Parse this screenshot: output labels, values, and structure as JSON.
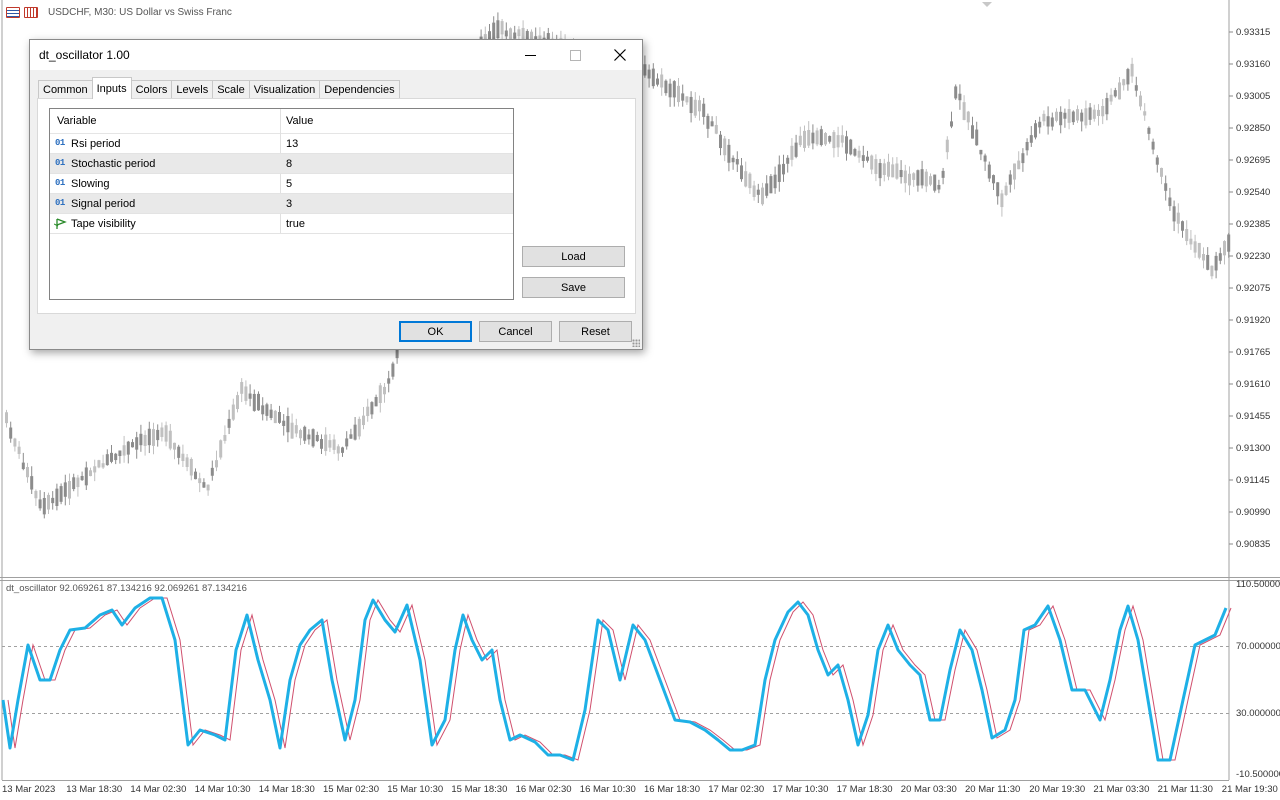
{
  "chart": {
    "title": "USDCHF, M30:  US Dollar vs Swiss Franc",
    "price_labels": [
      "0.93315",
      "0.93160",
      "0.93005",
      "0.92850",
      "0.92695",
      "0.92540",
      "0.92385",
      "0.92230",
      "0.92075",
      "0.91920",
      "0.91765",
      "0.91610",
      "0.91455",
      "0.91300",
      "0.91145",
      "0.90990",
      "0.90835"
    ],
    "price_range": [
      0.9074,
      0.934
    ],
    "indicator_label": "dt_oscillator 92.069261 87.134216 92.069261 87.134216",
    "indicator_levels": [
      "110.500000",
      "70.000000",
      "30.000000",
      "-10.500000"
    ],
    "indicator_range": [
      -10.5,
      110.5
    ],
    "time_labels": [
      "13 Mar 2023",
      "13 Mar 18:30",
      "14 Mar 02:30",
      "14 Mar 10:30",
      "14 Mar 18:30",
      "15 Mar 02:30",
      "15 Mar 10:30",
      "15 Mar 18:30",
      "16 Mar 02:30",
      "16 Mar 10:30",
      "16 Mar 18:30",
      "17 Mar 02:30",
      "17 Mar 10:30",
      "17 Mar 18:30",
      "20 Mar 03:30",
      "20 Mar 11:30",
      "20 Mar 19:30",
      "21 Mar 03:30",
      "21 Mar 11:30",
      "21 Mar 19:30"
    ],
    "colors": {
      "candles": "#8c8c8c",
      "candles_light": "#c0c0c0",
      "main_line": "#1eb0e6",
      "signal_line": "#d0506e",
      "level": "#a0a0a0"
    }
  },
  "dialog": {
    "title": "dt_oscillator 1.00",
    "tabs": [
      "Common",
      "Inputs",
      "Colors",
      "Levels",
      "Scale",
      "Visualization",
      "Dependencies"
    ],
    "active_tab": "Inputs",
    "grid": {
      "headers": {
        "variable": "Variable",
        "value": "Value"
      },
      "rows": [
        {
          "icon": "01",
          "variable": "Rsi period",
          "value": "13"
        },
        {
          "icon": "01",
          "variable": "Stochastic period",
          "value": "8"
        },
        {
          "icon": "01",
          "variable": "Slowing",
          "value": "5"
        },
        {
          "icon": "01",
          "variable": "Signal period",
          "value": "3"
        },
        {
          "icon": "flag-icon",
          "variable": "Tape visibility",
          "value": "true"
        }
      ]
    },
    "buttons": {
      "load": "Load",
      "save": "Save",
      "ok": "OK",
      "cancel": "Cancel",
      "reset": "Reset"
    }
  }
}
